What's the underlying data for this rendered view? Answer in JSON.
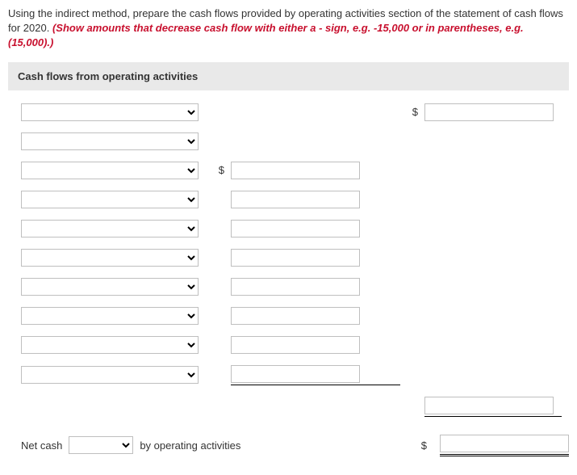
{
  "instructions": {
    "part1": "Using the indirect method, prepare the cash flows provided by operating activities section of the statement of cash flows for 2020. ",
    "part2": "(Show amounts that decrease cash flow with either a - sign, e.g. -15,000 or in parentheses, e.g. (15,000).)"
  },
  "section_header": "Cash flows from operating activities",
  "currency_symbol": "$",
  "rows": [
    {
      "select": "",
      "mid_dollar": false,
      "mid_amount": null,
      "right_dollar": true,
      "right_amount": ""
    },
    {
      "select": "",
      "mid_dollar": false,
      "mid_amount": null,
      "right_dollar": false,
      "right_amount": null
    },
    {
      "select": "",
      "mid_dollar": true,
      "mid_amount": "",
      "right_dollar": false,
      "right_amount": null
    },
    {
      "select": "",
      "mid_dollar": false,
      "mid_amount": "",
      "right_dollar": false,
      "right_amount": null
    },
    {
      "select": "",
      "mid_dollar": false,
      "mid_amount": "",
      "right_dollar": false,
      "right_amount": null
    },
    {
      "select": "",
      "mid_dollar": false,
      "mid_amount": "",
      "right_dollar": false,
      "right_amount": null
    },
    {
      "select": "",
      "mid_dollar": false,
      "mid_amount": "",
      "right_dollar": false,
      "right_amount": null
    },
    {
      "select": "",
      "mid_dollar": false,
      "mid_amount": "",
      "right_dollar": false,
      "right_amount": null
    },
    {
      "select": "",
      "mid_dollar": false,
      "mid_amount": "",
      "right_dollar": false,
      "right_amount": null
    },
    {
      "select": "",
      "mid_dollar": false,
      "mid_amount": "",
      "right_dollar": false,
      "right_amount": null,
      "mid_underline": true
    }
  ],
  "subtotal_row": {
    "right_amount": "",
    "right_underline": true
  },
  "netcash": {
    "prefix": "Net cash",
    "select": "",
    "suffix": "by operating activities",
    "right_dollar": true,
    "right_amount": ""
  }
}
